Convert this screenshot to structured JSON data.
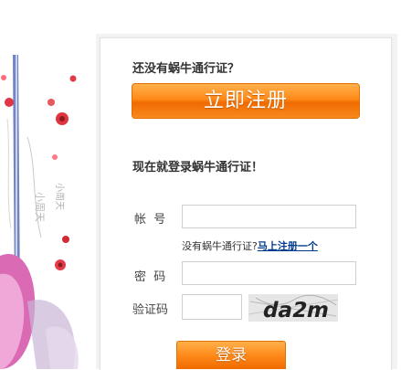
{
  "register_section": {
    "question": "还没有蜗牛通行证？",
    "register_button": "立即注册"
  },
  "login_section": {
    "title": "现在就登录蜗牛通行证！",
    "account_label": "帐  号",
    "account_value": "",
    "hint_text": "没有蜗牛通行证?",
    "hint_link": "马上注册一个",
    "password_label": "密  码",
    "password_value": "",
    "captcha_label": "验证码",
    "captcha_value": "",
    "captcha_image_text": "da2m",
    "login_button": "登录"
  },
  "decoration": {
    "calligraphy": "小周天"
  },
  "colors": {
    "accent_orange": "#ff8a1a",
    "link_blue": "#003a8c"
  }
}
